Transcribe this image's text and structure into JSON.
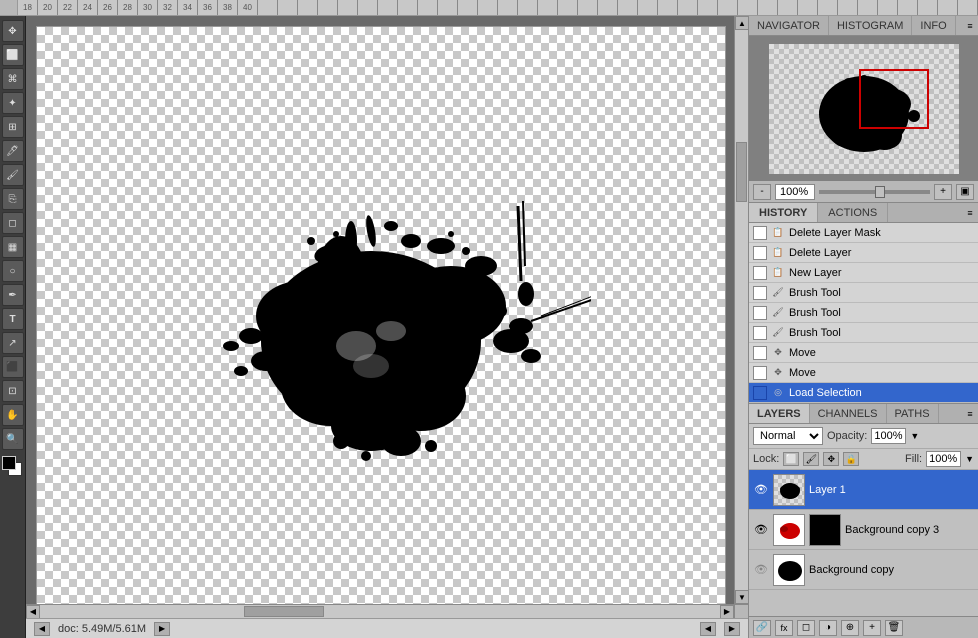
{
  "ruler": {
    "marks": "18 20 22 24 26 28 30 32 34 36 38 40"
  },
  "navigator": {
    "title": "NAVIGATOR",
    "histogram_title": "HISTOGRAM",
    "info_title": "INFO",
    "zoom_value": "100%"
  },
  "history": {
    "title": "HISTORY",
    "actions_title": "ACTIONS",
    "items": [
      {
        "label": "Delete Layer Mask",
        "icon": "📋"
      },
      {
        "label": "Delete Layer",
        "icon": "📋"
      },
      {
        "label": "New Layer",
        "icon": "📋"
      },
      {
        "label": "Brush Tool",
        "icon": "🖌"
      },
      {
        "label": "Brush Tool",
        "icon": "🖌"
      },
      {
        "label": "Brush Tool",
        "icon": "🖌"
      },
      {
        "label": "Move",
        "icon": "✥"
      },
      {
        "label": "Move",
        "icon": "✥"
      },
      {
        "label": "Load Selection",
        "icon": "◎"
      }
    ],
    "active_index": 8
  },
  "layers": {
    "tabs": {
      "layers": "LAYERS",
      "channels": "CHANNELS",
      "paths": "PATHS"
    },
    "blend_mode": "Normal",
    "opacity_label": "Opacity:",
    "opacity_value": "100%",
    "fill_label": "Fill:",
    "fill_value": "100%",
    "lock_label": "Lock:",
    "items": [
      {
        "name": "Layer 1",
        "visible": true,
        "active": true,
        "has_mask": false,
        "thumb_type": "checker_ink"
      },
      {
        "name": "Background copy 3",
        "visible": true,
        "active": false,
        "has_mask": true,
        "thumb_type": "red_ink"
      },
      {
        "name": "Background copy",
        "visible": false,
        "active": false,
        "has_mask": false,
        "thumb_type": "white"
      }
    ]
  },
  "status": {
    "doc_size": "doc: 5.49M/5.61M"
  },
  "bottom_toolbar": {
    "btns": [
      "🔗",
      "fx",
      "◻",
      "◱",
      "⊕",
      "🗑"
    ]
  }
}
